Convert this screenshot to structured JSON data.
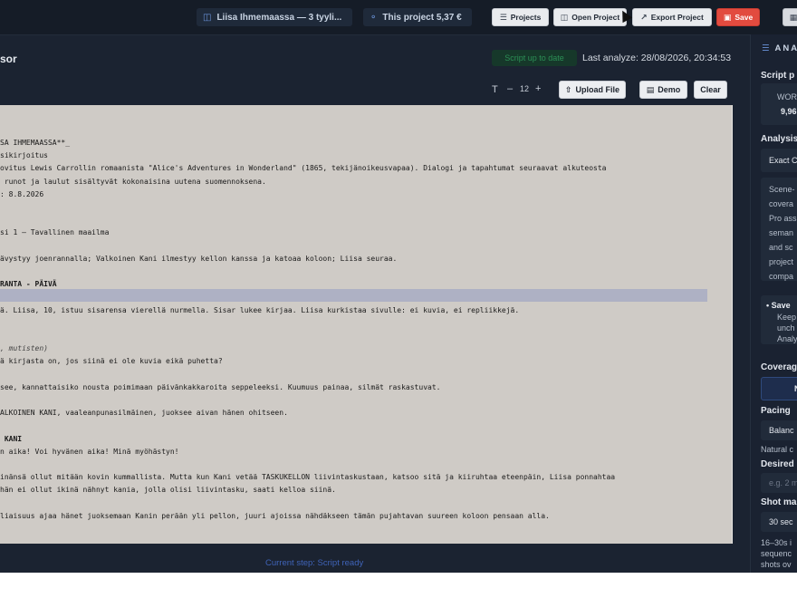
{
  "topbar": {
    "project_chip": "Liisa Ihmemaassa — 3 tyyli...",
    "cost_chip": "This project 5,37 €",
    "projects_label": "Projects",
    "open_project_label": "Open Project",
    "export_project_label": "Export Project",
    "save_label": "Save"
  },
  "editor": {
    "title": "sor",
    "status_badge": "Script up to date",
    "last_analyze": "Last analyze: 28/08/2026, 20:34:53",
    "font_size": "12",
    "upload_label": "Upload File",
    "demo_label": "Demo",
    "clear_label": "Clear",
    "lines": [
      {
        "text": "SA IHMEMAASSA**_",
        "style": "normal"
      },
      {
        "text": "sikirjoitus",
        "style": "normal"
      },
      {
        "text": "ovitus Lewis Carrollin romaanista \"Alice's Adventures in Wonderland\" (1865, tekijänoikeusvapaa). Dialogi ja tapahtumat seuraavat alkuteosta",
        "style": "normal"
      },
      {
        "text": " runot ja laulut sisältyvät kokonaisina uutena suomennoksena.",
        "style": "normal"
      },
      {
        "text": ": 8.8.2026",
        "style": "normal"
      },
      {
        "text": "",
        "style": "normal"
      },
      {
        "text": "",
        "style": "normal"
      },
      {
        "text": "si 1 — Tavallinen maailma",
        "style": "normal"
      },
      {
        "text": "",
        "style": "normal"
      },
      {
        "text": "ävystyy joenrannalla; Valkoinen Kani ilmestyy kellon kanssa ja katoaa koloon; Liisa seuraa.",
        "style": "normal"
      },
      {
        "text": "",
        "style": "normal"
      },
      {
        "text": "RANTA - PÄIVÄ",
        "style": "bold"
      },
      {
        "text": "",
        "style": "normal"
      },
      {
        "text": "ä. Liisa, 10, istuu sisarensa vierellä nurmella. Sisar lukee kirjaa. Liisa kurkistaa sivulle: ei kuvia, ei repliikkejä.",
        "style": "normal"
      },
      {
        "text": "",
        "style": "normal"
      },
      {
        "text": "",
        "style": "normal"
      },
      {
        "text": ", mutisten)",
        "style": "italic"
      },
      {
        "text": "ä kirjasta on, jos siinä ei ole kuvia eikä puhetta?",
        "style": "normal"
      },
      {
        "text": "",
        "style": "normal"
      },
      {
        "text": "see, kannattaisiko nousta poimimaan päivänkakkaroita seppeleeksi. Kuumuus painaa, silmät raskastuvat.",
        "style": "normal"
      },
      {
        "text": "",
        "style": "normal"
      },
      {
        "text": "ALKOINEN KANI, vaaleanpunasilmäinen, juoksee aivan hänen ohitseen.",
        "style": "normal"
      },
      {
        "text": "",
        "style": "normal"
      },
      {
        "text": " KANI",
        "style": "bold"
      },
      {
        "text": "n aika! Voi hyvänen aika! Minä myöhästyn!",
        "style": "normal"
      },
      {
        "text": "",
        "style": "normal"
      },
      {
        "text": "inänsä ollut mitään kovin kummallista. Mutta kun Kani vetää TASKUKELLON liivintaskustaan, katsoo sitä ja kiiruhtaa eteenpäin, Liisa ponnahtaa",
        "style": "normal"
      },
      {
        "text": "hän ei ollut ikinä nähnyt kania, jolla olisi liivintasku, saati kelloa siinä.",
        "style": "normal"
      },
      {
        "text": "",
        "style": "normal"
      },
      {
        "text": "liaisuus ajaa hänet juoksemaan Kanin perään yli pellon, juuri ajoissa nähdäkseen tämän pujahtavan suureen koloon pensaan alla.",
        "style": "normal"
      }
    ]
  },
  "footer": {
    "current_step": "Current step: Script ready"
  },
  "analysis": {
    "title": "ANA",
    "script_label": "Script p",
    "words_label": "WOR",
    "words_value": "9,96",
    "analysis_label": "Analysis",
    "analysis_value": "Exact C",
    "desc_lines": [
      "Scene-",
      "covera",
      "Pro ass",
      "seman",
      "and sc",
      "project",
      "compa"
    ],
    "save_title": "Save",
    "save_lines": [
      "Keep",
      "unch",
      "Analy"
    ],
    "coverage_label": "Coverag",
    "coverage_value": "N",
    "pacing_label": "Pacing",
    "pacing_value": "Balanc",
    "natural_label": "Natural c",
    "desired_label": "Desired",
    "desired_placeholder": "e.g. 2 m",
    "shotmax_label": "Shot ma",
    "shotmax_value": "30 sec",
    "bottom_lines": [
      "16–30s i",
      "sequenc",
      "shots ov"
    ]
  },
  "colors": {
    "accent": "#6a93d8",
    "save": "#e24b3f",
    "highlight": "#aeb1c4",
    "paper": "#cfcbc6"
  }
}
